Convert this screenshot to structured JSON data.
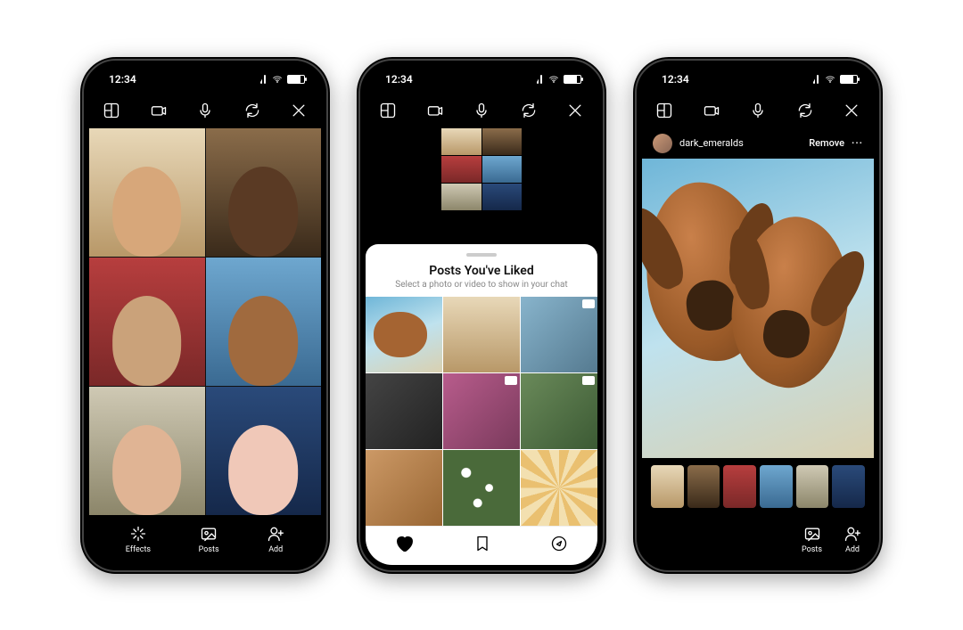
{
  "status": {
    "time": "12:34"
  },
  "toolbar": {
    "layout_icon": "layout-icon",
    "camera_icon": "camera-flip-icon",
    "mic_icon": "microphone-icon",
    "refresh_icon": "refresh-icon",
    "close_icon": "close-icon"
  },
  "phone1": {
    "bottom": {
      "effects": "Effects",
      "posts": "Posts",
      "add": "Add"
    }
  },
  "phone2": {
    "sheet": {
      "title": "Posts You've Liked",
      "subtitle": "Select a photo or video to show in your chat"
    },
    "tabs": {
      "liked": "liked-tab",
      "saved": "saved-tab",
      "explore": "explore-tab"
    }
  },
  "phone3": {
    "media": {
      "username": "dark_emeralds",
      "remove": "Remove",
      "more": "···"
    },
    "bottom": {
      "posts": "Posts",
      "add": "Add"
    }
  }
}
